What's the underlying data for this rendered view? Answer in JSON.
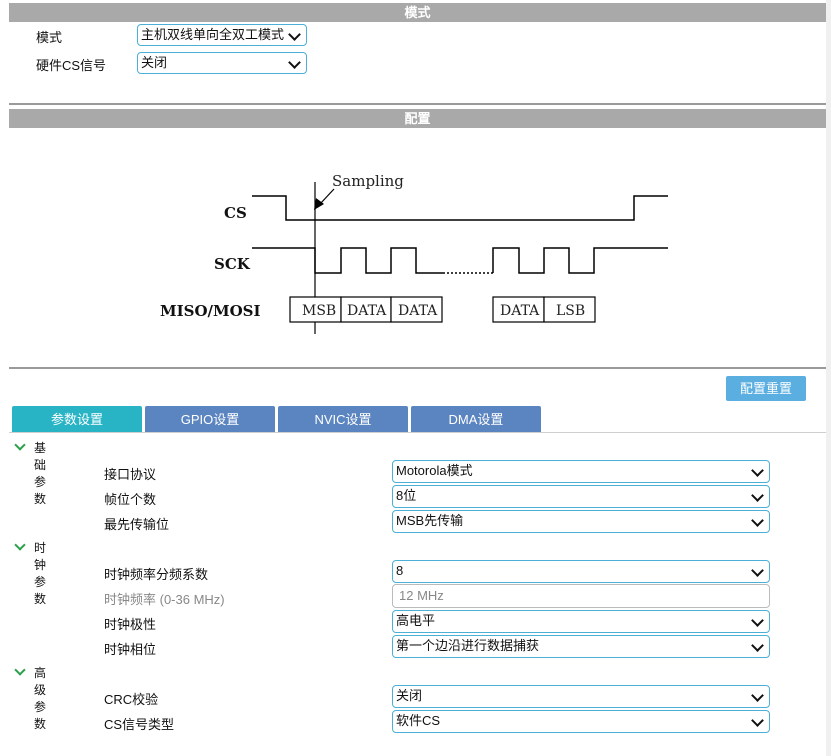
{
  "mode_section": {
    "title": "模式",
    "rows": [
      {
        "label": "模式",
        "value": "主机双线单向全双工模式"
      },
      {
        "label": "硬件CS信号",
        "value": "关闭"
      }
    ]
  },
  "config_section": {
    "title": "配置",
    "diagram": {
      "sampling": "Sampling",
      "cs": "CS",
      "sck": "SCK",
      "miso_mosi": "MISO/MOSI",
      "cells": [
        "MSB",
        "DATA",
        "DATA",
        "DATA",
        "LSB"
      ]
    }
  },
  "reset_button": "配置重置",
  "tabs": [
    {
      "label": "参数设置",
      "active": true
    },
    {
      "label": "GPIO设置",
      "active": false
    },
    {
      "label": "NVIC设置",
      "active": false
    },
    {
      "label": "DMA设置",
      "active": false
    }
  ],
  "groups": {
    "basic": {
      "title": "基础参数",
      "params": [
        {
          "label": "接口协议",
          "value": "Motorola模式"
        },
        {
          "label": "帧位个数",
          "value": "8位"
        },
        {
          "label": "最先传输位",
          "value": "MSB先传输"
        }
      ]
    },
    "clock": {
      "title": "时钟参数",
      "params": [
        {
          "label": "时钟频率分频系数",
          "value": "8"
        },
        {
          "label": "时钟频率 (0-36 MHz)",
          "value": "12 MHz"
        },
        {
          "label": "时钟极性",
          "value": "高电平"
        },
        {
          "label": "时钟相位",
          "value": "第一个边沿进行数据捕获"
        }
      ]
    },
    "advanced": {
      "title": "高级参数",
      "params": [
        {
          "label": "CRC校验",
          "value": "关闭"
        },
        {
          "label": "CS信号类型",
          "value": "软件CS"
        }
      ]
    }
  },
  "colors": {
    "accent_active_tab": "#29b4c6",
    "inactive_tab": "#5b85c0",
    "select_border": "#4ab0d8",
    "reset_button": "#5aaee0",
    "group_chevron": "#2aa04a"
  }
}
